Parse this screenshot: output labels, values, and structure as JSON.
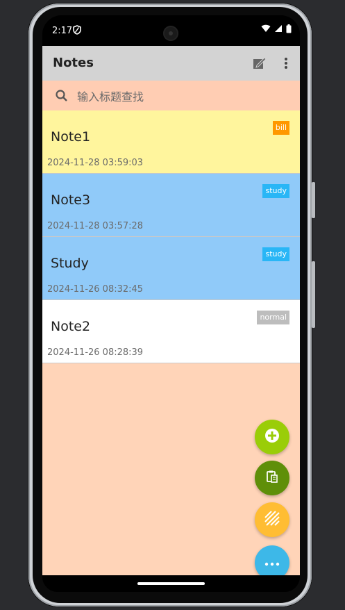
{
  "status": {
    "time": "2:17"
  },
  "appbar": {
    "title": "Notes"
  },
  "search": {
    "placeholder": "输入标题查找"
  },
  "notes": [
    {
      "title": "Note1",
      "date": "2024-11-28 03:59:03",
      "tag": "bill",
      "bg": "#fff59d",
      "tag_color": "#ff9800"
    },
    {
      "title": "Note3",
      "date": "2024-11-28 03:57:28",
      "tag": "study",
      "bg": "#90caf9",
      "tag_color": "#29b6f6"
    },
    {
      "title": "Study",
      "date": "2024-11-26 08:32:45",
      "tag": "study",
      "bg": "#90caf9",
      "tag_color": "#29b6f6"
    },
    {
      "title": "Note2",
      "date": "2024-11-26 08:28:39",
      "tag": "normal",
      "bg": "#ffffff",
      "tag_color": "#bdbdbd"
    }
  ],
  "fabs": [
    {
      "name": "add-note-fab",
      "icon": "plus-circle-icon",
      "color": "#9acd08"
    },
    {
      "name": "paste-fab",
      "icon": "clipboard-icon",
      "color": "#5f8f09"
    },
    {
      "name": "stripes-fab",
      "icon": "stripes-icon",
      "color": "#ffbd33"
    },
    {
      "name": "more-fab",
      "icon": "more-horizontal-icon",
      "color": "#3db8e8"
    }
  ]
}
